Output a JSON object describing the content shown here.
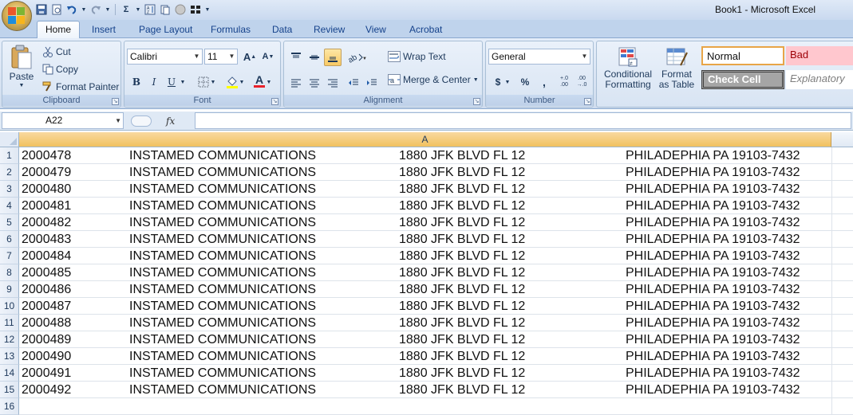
{
  "window": {
    "title": "Book1 - Microsoft Excel"
  },
  "tabs": [
    "Home",
    "Insert",
    "Page Layout",
    "Formulas",
    "Data",
    "Review",
    "View",
    "Acrobat"
  ],
  "clipboard": {
    "paste": "Paste",
    "cut": "Cut",
    "copy": "Copy",
    "format_painter": "Format Painter",
    "label": "Clipboard"
  },
  "font": {
    "name": "Calibri",
    "size": "11",
    "label": "Font",
    "bold": "B",
    "italic": "I",
    "underline": "U",
    "color_letter": "A"
  },
  "alignment": {
    "wrap_text": "Wrap Text",
    "merge_center": "Merge & Center",
    "label": "Alignment"
  },
  "number": {
    "format": "General",
    "currency": "$",
    "percent": "%",
    "comma": ",",
    "inc_decimal": "+.0 .00",
    "dec_decimal": ".00 →.0",
    "label": "Number"
  },
  "styles": {
    "conditional": "Conditional Formatting",
    "format_table": "Format as Table",
    "normal": "Normal",
    "bad": "Bad",
    "check_cell": "Check Cell",
    "explanatory": "Explanatory"
  },
  "formula_bar": {
    "name_box": "A22",
    "fx": "fx"
  },
  "sheet": {
    "column_header": "A",
    "rows": [
      {
        "n": "1",
        "id": "2000478",
        "company": "INSTAMED COMMUNICATIONS",
        "address": "1880 JFK BLVD FL 12",
        "city": "PHILADEPHIA PA 19103-7432"
      },
      {
        "n": "2",
        "id": "2000479",
        "company": "INSTAMED COMMUNICATIONS",
        "address": "1880 JFK BLVD FL 12",
        "city": "PHILADEPHIA PA 19103-7432"
      },
      {
        "n": "3",
        "id": "2000480",
        "company": "INSTAMED COMMUNICATIONS",
        "address": "1880 JFK BLVD FL 12",
        "city": "PHILADEPHIA PA 19103-7432"
      },
      {
        "n": "4",
        "id": "2000481",
        "company": "INSTAMED COMMUNICATIONS",
        "address": "1880 JFK BLVD FL 12",
        "city": "PHILADEPHIA PA 19103-7432"
      },
      {
        "n": "5",
        "id": "2000482",
        "company": "INSTAMED COMMUNICATIONS",
        "address": "1880 JFK BLVD FL 12",
        "city": "PHILADEPHIA PA 19103-7432"
      },
      {
        "n": "6",
        "id": "2000483",
        "company": "INSTAMED COMMUNICATIONS",
        "address": "1880 JFK BLVD FL 12",
        "city": "PHILADEPHIA PA 19103-7432"
      },
      {
        "n": "7",
        "id": "2000484",
        "company": "INSTAMED COMMUNICATIONS",
        "address": "1880 JFK BLVD FL 12",
        "city": "PHILADEPHIA PA 19103-7432"
      },
      {
        "n": "8",
        "id": "2000485",
        "company": "INSTAMED COMMUNICATIONS",
        "address": "1880 JFK BLVD FL 12",
        "city": "PHILADEPHIA PA 19103-7432"
      },
      {
        "n": "9",
        "id": "2000486",
        "company": "INSTAMED COMMUNICATIONS",
        "address": "1880 JFK BLVD FL 12",
        "city": "PHILADEPHIA PA 19103-7432"
      },
      {
        "n": "10",
        "id": "2000487",
        "company": "INSTAMED COMMUNICATIONS",
        "address": "1880 JFK BLVD FL 12",
        "city": "PHILADEPHIA PA 19103-7432"
      },
      {
        "n": "11",
        "id": "2000488",
        "company": "INSTAMED COMMUNICATIONS",
        "address": "1880 JFK BLVD FL 12",
        "city": "PHILADEPHIA PA 19103-7432"
      },
      {
        "n": "12",
        "id": "2000489",
        "company": "INSTAMED COMMUNICATIONS",
        "address": "1880 JFK BLVD FL 12",
        "city": "PHILADEPHIA PA 19103-7432"
      },
      {
        "n": "13",
        "id": "2000490",
        "company": "INSTAMED COMMUNICATIONS",
        "address": "1880 JFK BLVD FL 12",
        "city": "PHILADEPHIA PA 19103-7432"
      },
      {
        "n": "14",
        "id": "2000491",
        "company": "INSTAMED COMMUNICATIONS",
        "address": "1880 JFK BLVD FL 12",
        "city": "PHILADEPHIA PA 19103-7432"
      },
      {
        "n": "15",
        "id": "2000492",
        "company": "INSTAMED COMMUNICATIONS",
        "address": "1880 JFK BLVD FL 12",
        "city": "PHILADEPHIA PA 19103-7432"
      },
      {
        "n": "16",
        "id": "",
        "company": "",
        "address": "",
        "city": ""
      }
    ]
  },
  "colors": {
    "column_header_selected": "#f1c15f",
    "ribbon": "#dbe6f4",
    "bad_fill": "#ffc7ce",
    "check_cell_fill": "#a5a5a5"
  }
}
